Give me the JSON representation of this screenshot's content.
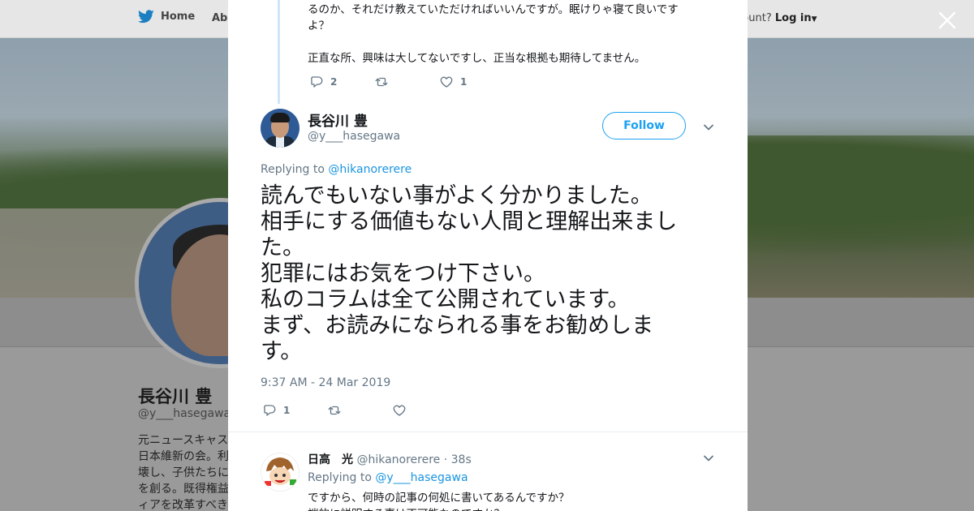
{
  "nav": {
    "home_label": "Home",
    "about_label": "Abo",
    "account_prompt": "ccount?",
    "login_label": "Log in"
  },
  "profile": {
    "name": "長谷川 豊",
    "handle": "@y___hasegawa",
    "bio": "元ニュースキャス\n日本維新の会。利\n壊し、子供たちに\nを創る。既得権益\nィアを改革すべき"
  },
  "previous_tweet": {
    "text": "るのか、それだけ教えていただければいいんですが。眠けりゃ寝て良いです\nよ？\n\n正直な所、興味は大してないですし、正当な根拠も期待してません。",
    "reply_count": "2",
    "retweet_count": "",
    "like_count": "1"
  },
  "tweet": {
    "author_name": "長谷川 豊",
    "author_handle": "@y___hasegawa",
    "follow_label": "Follow",
    "replying_prefix": "Replying to",
    "replying_to": "@hikanorerere",
    "text": "読んでもいない事がよく分かりました。\n相手にする価値もない人間と理解出来まし\nた。\n犯罪にはお気をつけ下さい。\n私のコラムは全て公開されています。\nまず、お読みになられる事をお勧めしま\nす。",
    "timestamp": "9:37 AM - 24 Mar 2019",
    "reply_count": "1",
    "retweet_count": "",
    "like_count": ""
  },
  "reply": {
    "author_name": "日高　光",
    "author_handle": "@hikanorerere",
    "age": "· 38s",
    "replying_prefix": "Replying to",
    "replying_to": "@y___hasegawa",
    "text": "ですから、何時の記事の何処に書いてあるんですか？\n端的に説明する事は不可能なのですか？"
  },
  "colors": {
    "accent": "#1da1f2",
    "link": "#1b95e0",
    "muted": "#657786",
    "text": "#14171a"
  },
  "icons": [
    "twitter-bird-icon",
    "close-icon",
    "reply-icon",
    "retweet-icon",
    "like-icon",
    "chevron-down-icon"
  ]
}
